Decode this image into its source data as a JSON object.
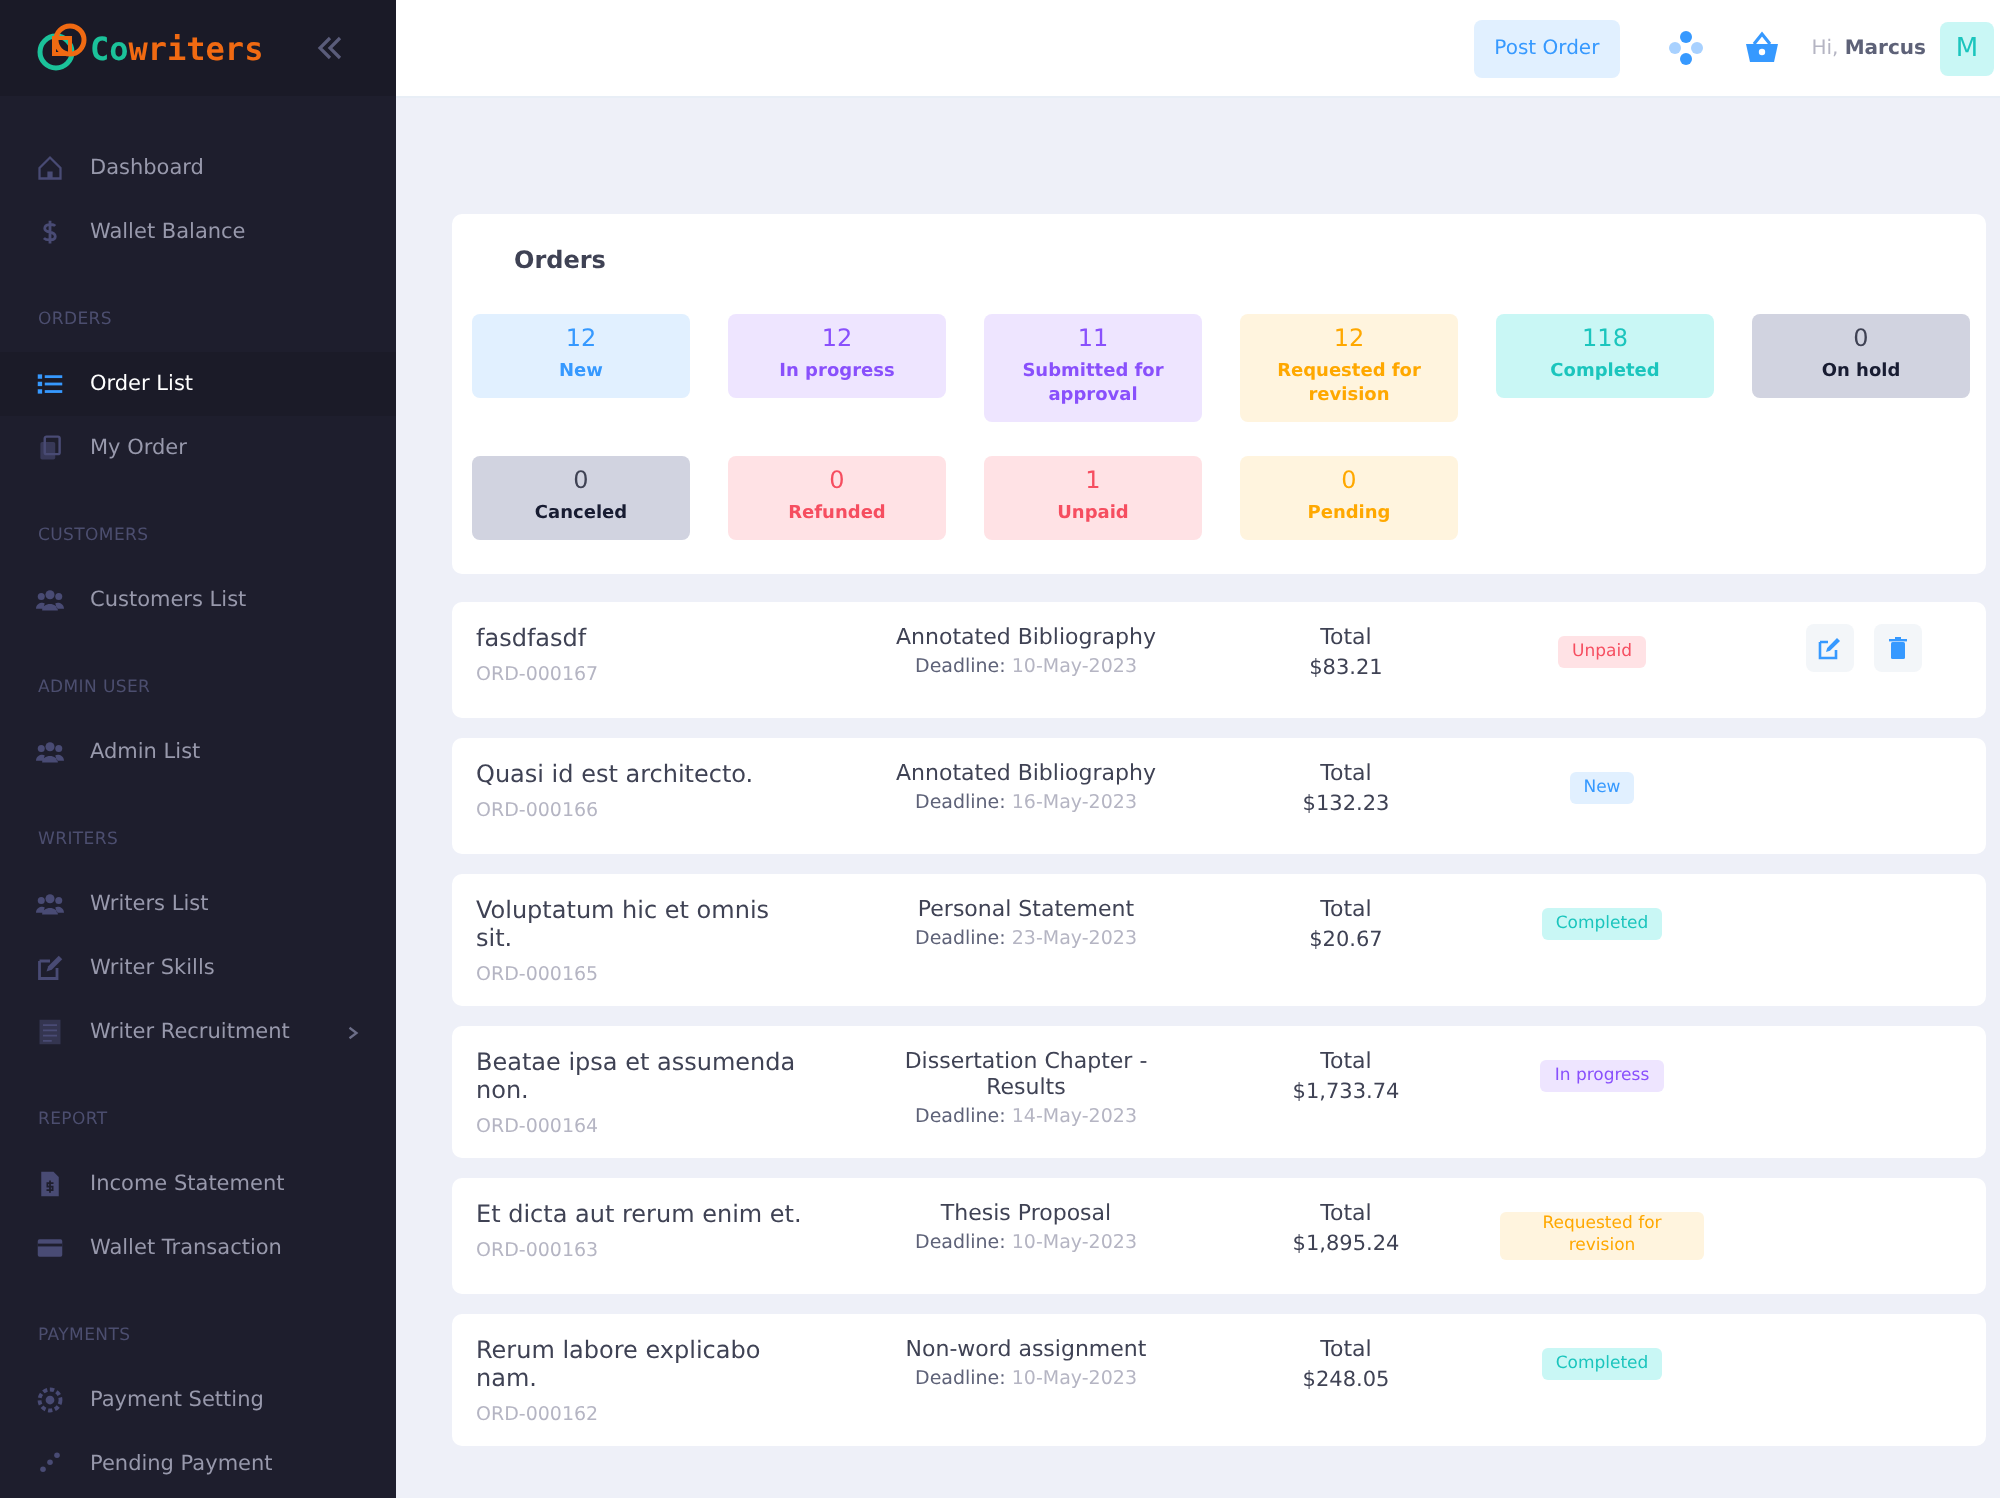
{
  "brand": {
    "name_start": "Co",
    "name_end": "writers"
  },
  "sidebar": {
    "sections": [
      {
        "items": [
          {
            "label": "Dashboard",
            "selected": false
          },
          {
            "label": "Wallet Balance",
            "selected": false
          }
        ]
      },
      {
        "title": "ORDERS",
        "items": [
          {
            "label": "Order List",
            "selected": true
          },
          {
            "label": "My Order",
            "selected": false
          }
        ]
      },
      {
        "title": "CUSTOMERS",
        "items": [
          {
            "label": "Customers List",
            "selected": false
          }
        ]
      },
      {
        "title": "ADMIN USER",
        "items": [
          {
            "label": "Admin List",
            "selected": false
          }
        ]
      },
      {
        "title": "WRITERS",
        "items": [
          {
            "label": "Writers List",
            "selected": false
          },
          {
            "label": "Writer Skills",
            "selected": false
          },
          {
            "label": "Writer Recruitment",
            "selected": false,
            "submenu": true
          }
        ]
      },
      {
        "title": "REPORT",
        "items": [
          {
            "label": "Income Statement",
            "selected": false
          },
          {
            "label": "Wallet Transaction",
            "selected": false
          }
        ]
      },
      {
        "title": "PAYMENTS",
        "items": [
          {
            "label": "Payment Setting",
            "selected": false
          },
          {
            "label": "Pending Payment",
            "selected": false
          }
        ]
      }
    ]
  },
  "header": {
    "post_button": "Post Order",
    "greeting": "Hi,",
    "user": "Marcus",
    "avatar": "M"
  },
  "orders_card": {
    "title": "Orders",
    "stats": [
      {
        "count": "12",
        "label": "New",
        "kind": "new"
      },
      {
        "count": "12",
        "label": "In progress",
        "kind": "progress"
      },
      {
        "count": "11",
        "label": "Submitted for approval",
        "kind": "submitted"
      },
      {
        "count": "12",
        "label": "Requested for revision",
        "kind": "revision"
      },
      {
        "count": "118",
        "label": "Completed",
        "kind": "completed"
      },
      {
        "count": "0",
        "label": "On hold",
        "kind": "hold"
      },
      {
        "count": "0",
        "label": "Canceled",
        "kind": "canceled"
      },
      {
        "count": "0",
        "label": "Refunded",
        "kind": "refunded"
      },
      {
        "count": "1",
        "label": "Unpaid",
        "kind": "unpaid"
      },
      {
        "count": "0",
        "label": "Pending",
        "kind": "pending"
      }
    ]
  },
  "orders": [
    {
      "title": "fasdfasdf",
      "id": "ORD-000167",
      "type": "Annotated Bibliography",
      "deadline_label": "Deadline:",
      "deadline": "10-May-2023",
      "total_label": "Total",
      "total": "$83.21",
      "status": "Unpaid",
      "kind": "unpaid",
      "actions": true
    },
    {
      "title": "Quasi id est architecto.",
      "id": "ORD-000166",
      "type": "Annotated Bibliography",
      "deadline_label": "Deadline:",
      "deadline": "16-May-2023",
      "total_label": "Total",
      "total": "$132.23",
      "status": "New",
      "kind": "new",
      "actions": false
    },
    {
      "title": "Voluptatum hic et omnis sit.",
      "id": "ORD-000165",
      "type": "Personal Statement",
      "deadline_label": "Deadline:",
      "deadline": "23-May-2023",
      "total_label": "Total",
      "total": "$20.67",
      "status": "Completed",
      "kind": "completed",
      "actions": false
    },
    {
      "title": "Beatae ipsa et assumenda non.",
      "id": "ORD-000164",
      "type": "Dissertation Chapter - Results",
      "deadline_label": "Deadline:",
      "deadline": "14-May-2023",
      "total_label": "Total",
      "total": "$1,733.74",
      "status": "In progress",
      "kind": "progress",
      "actions": false
    },
    {
      "title": "Et dicta aut rerum enim et.",
      "id": "ORD-000163",
      "type": "Thesis Proposal",
      "deadline_label": "Deadline:",
      "deadline": "10-May-2023",
      "total_label": "Total",
      "total": "$1,895.24",
      "status": "Requested for revision",
      "kind": "revision",
      "actions": false
    },
    {
      "title": "Rerum labore explicabo nam.",
      "id": "ORD-000162",
      "type": "Non-word assignment",
      "deadline_label": "Deadline:",
      "deadline": "10-May-2023",
      "total_label": "Total",
      "total": "$248.05",
      "status": "Completed",
      "kind": "completed",
      "actions": false
    }
  ]
}
